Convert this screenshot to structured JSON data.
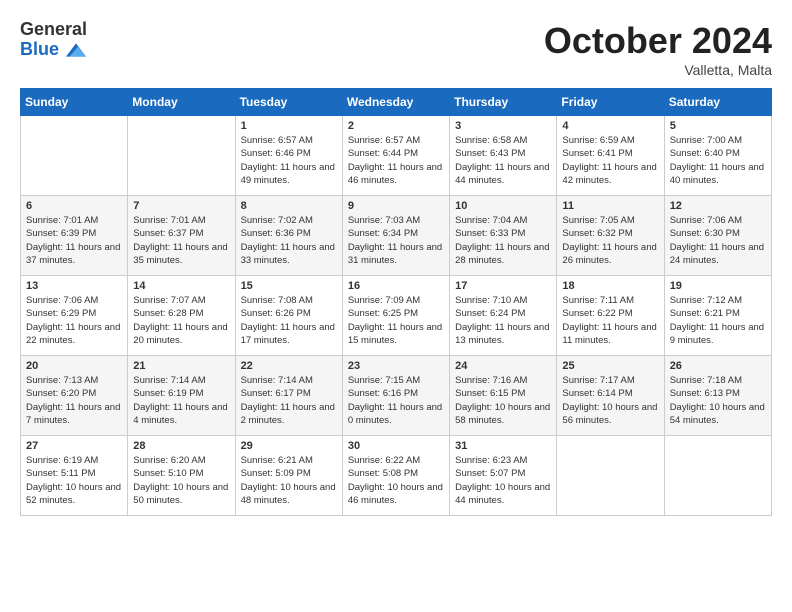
{
  "header": {
    "logo_general": "General",
    "logo_blue": "Blue",
    "month_title": "October 2024",
    "location": "Valletta, Malta"
  },
  "weekdays": [
    "Sunday",
    "Monday",
    "Tuesday",
    "Wednesday",
    "Thursday",
    "Friday",
    "Saturday"
  ],
  "weeks": [
    [
      {
        "day": "",
        "info": ""
      },
      {
        "day": "",
        "info": ""
      },
      {
        "day": "1",
        "info": "Sunrise: 6:57 AM\nSunset: 6:46 PM\nDaylight: 11 hours and 49 minutes."
      },
      {
        "day": "2",
        "info": "Sunrise: 6:57 AM\nSunset: 6:44 PM\nDaylight: 11 hours and 46 minutes."
      },
      {
        "day": "3",
        "info": "Sunrise: 6:58 AM\nSunset: 6:43 PM\nDaylight: 11 hours and 44 minutes."
      },
      {
        "day": "4",
        "info": "Sunrise: 6:59 AM\nSunset: 6:41 PM\nDaylight: 11 hours and 42 minutes."
      },
      {
        "day": "5",
        "info": "Sunrise: 7:00 AM\nSunset: 6:40 PM\nDaylight: 11 hours and 40 minutes."
      }
    ],
    [
      {
        "day": "6",
        "info": "Sunrise: 7:01 AM\nSunset: 6:39 PM\nDaylight: 11 hours and 37 minutes."
      },
      {
        "day": "7",
        "info": "Sunrise: 7:01 AM\nSunset: 6:37 PM\nDaylight: 11 hours and 35 minutes."
      },
      {
        "day": "8",
        "info": "Sunrise: 7:02 AM\nSunset: 6:36 PM\nDaylight: 11 hours and 33 minutes."
      },
      {
        "day": "9",
        "info": "Sunrise: 7:03 AM\nSunset: 6:34 PM\nDaylight: 11 hours and 31 minutes."
      },
      {
        "day": "10",
        "info": "Sunrise: 7:04 AM\nSunset: 6:33 PM\nDaylight: 11 hours and 28 minutes."
      },
      {
        "day": "11",
        "info": "Sunrise: 7:05 AM\nSunset: 6:32 PM\nDaylight: 11 hours and 26 minutes."
      },
      {
        "day": "12",
        "info": "Sunrise: 7:06 AM\nSunset: 6:30 PM\nDaylight: 11 hours and 24 minutes."
      }
    ],
    [
      {
        "day": "13",
        "info": "Sunrise: 7:06 AM\nSunset: 6:29 PM\nDaylight: 11 hours and 22 minutes."
      },
      {
        "day": "14",
        "info": "Sunrise: 7:07 AM\nSunset: 6:28 PM\nDaylight: 11 hours and 20 minutes."
      },
      {
        "day": "15",
        "info": "Sunrise: 7:08 AM\nSunset: 6:26 PM\nDaylight: 11 hours and 17 minutes."
      },
      {
        "day": "16",
        "info": "Sunrise: 7:09 AM\nSunset: 6:25 PM\nDaylight: 11 hours and 15 minutes."
      },
      {
        "day": "17",
        "info": "Sunrise: 7:10 AM\nSunset: 6:24 PM\nDaylight: 11 hours and 13 minutes."
      },
      {
        "day": "18",
        "info": "Sunrise: 7:11 AM\nSunset: 6:22 PM\nDaylight: 11 hours and 11 minutes."
      },
      {
        "day": "19",
        "info": "Sunrise: 7:12 AM\nSunset: 6:21 PM\nDaylight: 11 hours and 9 minutes."
      }
    ],
    [
      {
        "day": "20",
        "info": "Sunrise: 7:13 AM\nSunset: 6:20 PM\nDaylight: 11 hours and 7 minutes."
      },
      {
        "day": "21",
        "info": "Sunrise: 7:14 AM\nSunset: 6:19 PM\nDaylight: 11 hours and 4 minutes."
      },
      {
        "day": "22",
        "info": "Sunrise: 7:14 AM\nSunset: 6:17 PM\nDaylight: 11 hours and 2 minutes."
      },
      {
        "day": "23",
        "info": "Sunrise: 7:15 AM\nSunset: 6:16 PM\nDaylight: 11 hours and 0 minutes."
      },
      {
        "day": "24",
        "info": "Sunrise: 7:16 AM\nSunset: 6:15 PM\nDaylight: 10 hours and 58 minutes."
      },
      {
        "day": "25",
        "info": "Sunrise: 7:17 AM\nSunset: 6:14 PM\nDaylight: 10 hours and 56 minutes."
      },
      {
        "day": "26",
        "info": "Sunrise: 7:18 AM\nSunset: 6:13 PM\nDaylight: 10 hours and 54 minutes."
      }
    ],
    [
      {
        "day": "27",
        "info": "Sunrise: 6:19 AM\nSunset: 5:11 PM\nDaylight: 10 hours and 52 minutes."
      },
      {
        "day": "28",
        "info": "Sunrise: 6:20 AM\nSunset: 5:10 PM\nDaylight: 10 hours and 50 minutes."
      },
      {
        "day": "29",
        "info": "Sunrise: 6:21 AM\nSunset: 5:09 PM\nDaylight: 10 hours and 48 minutes."
      },
      {
        "day": "30",
        "info": "Sunrise: 6:22 AM\nSunset: 5:08 PM\nDaylight: 10 hours and 46 minutes."
      },
      {
        "day": "31",
        "info": "Sunrise: 6:23 AM\nSunset: 5:07 PM\nDaylight: 10 hours and 44 minutes."
      },
      {
        "day": "",
        "info": ""
      },
      {
        "day": "",
        "info": ""
      }
    ]
  ]
}
